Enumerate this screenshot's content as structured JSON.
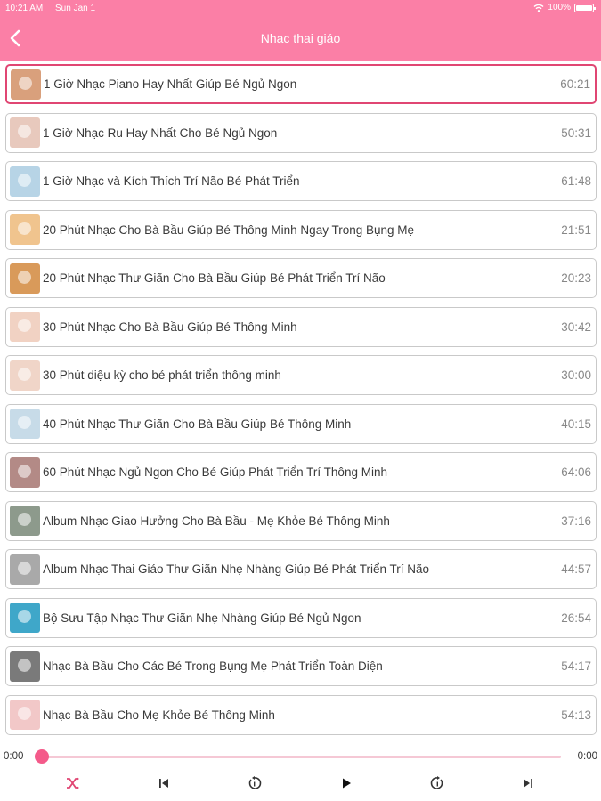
{
  "status_bar": {
    "time": "10:21 AM",
    "date": "Sun Jan 1",
    "battery": "100%"
  },
  "nav": {
    "title": "Nhạc thai giáo"
  },
  "colors": {
    "header": "#fb7fa6",
    "accent": "#e04673",
    "slider": "#f45a8a"
  },
  "tracks": [
    {
      "title": "1 Giờ Nhạc Piano Hay Nhất Giúp Bé Ngủ Ngon",
      "duration": "60:21",
      "active": true,
      "thumb_color": "#d9a07c"
    },
    {
      "title": "1 Giờ Nhạc Ru Hay Nhất Cho Bé Ngủ Ngon",
      "duration": "50:31",
      "thumb_color": "#e8c9bd"
    },
    {
      "title": "1 Giờ Nhạc và Kích Thích Trí Não Bé Phát Triển",
      "duration": "61:48",
      "thumb_color": "#b7d4e6"
    },
    {
      "title": "20 Phút Nhạc Cho Bà Bầu Giúp Bé Thông Minh Ngay Trong Bụng Mẹ",
      "duration": "21:51",
      "thumb_color": "#f0c48e"
    },
    {
      "title": "20 Phút Nhạc Thư Giãn Cho Bà Bầu Giúp Bé Phát Triển Trí Não",
      "duration": "20:23",
      "thumb_color": "#d99a5a"
    },
    {
      "title": "30 Phút Nhạc Cho Bà Bầu Giúp Bé Thông Minh",
      "duration": "30:42",
      "thumb_color": "#f1d2c3"
    },
    {
      "title": "30 Phút diệu kỳ cho bé phát triển thông minh",
      "duration": "30:00",
      "thumb_color": "#f0d5c8"
    },
    {
      "title": "40 Phút Nhạc Thư Giãn Cho Bà Bầu Giúp Bé Thông Minh",
      "duration": "40:15",
      "thumb_color": "#c7dbe8"
    },
    {
      "title": "60 Phút Nhạc Ngủ Ngon Cho Bé Giúp Phát Triển Trí Thông Minh",
      "duration": "64:06",
      "thumb_color": "#b38a86"
    },
    {
      "title": "Album Nhạc Giao Hưởng Cho Bà Bầu - Mẹ Khỏe Bé Thông Minh",
      "duration": "37:16",
      "thumb_color": "#8d9a8c"
    },
    {
      "title": "Album Nhạc Thai Giáo Thư Giãn Nhẹ Nhàng Giúp Bé Phát Triển Trí Não",
      "duration": "44:57",
      "thumb_color": "#a9a9a9"
    },
    {
      "title": "Bộ Sưu Tập Nhạc Thư Giãn Nhẹ Nhàng Giúp Bé Ngủ Ngon",
      "duration": "26:54",
      "thumb_color": "#3fa7c9"
    },
    {
      "title": "Nhạc Bà Bầu Cho Các Bé Trong Bụng Mẹ Phát Triển Toàn Diện",
      "duration": "54:17",
      "thumb_color": "#7a7a7a"
    },
    {
      "title": "Nhạc Bà Bầu Cho Mẹ Khỏe Bé Thông Minh",
      "duration": "54:13",
      "thumb_color": "#f2c8c8"
    }
  ],
  "player": {
    "current_time": "0:00",
    "total_time": "0:00",
    "progress": 0
  },
  "controls": [
    {
      "name": "shuffle-icon"
    },
    {
      "name": "previous-icon"
    },
    {
      "name": "rewind-icon"
    },
    {
      "name": "play-icon"
    },
    {
      "name": "forward-icon"
    },
    {
      "name": "next-icon"
    }
  ]
}
